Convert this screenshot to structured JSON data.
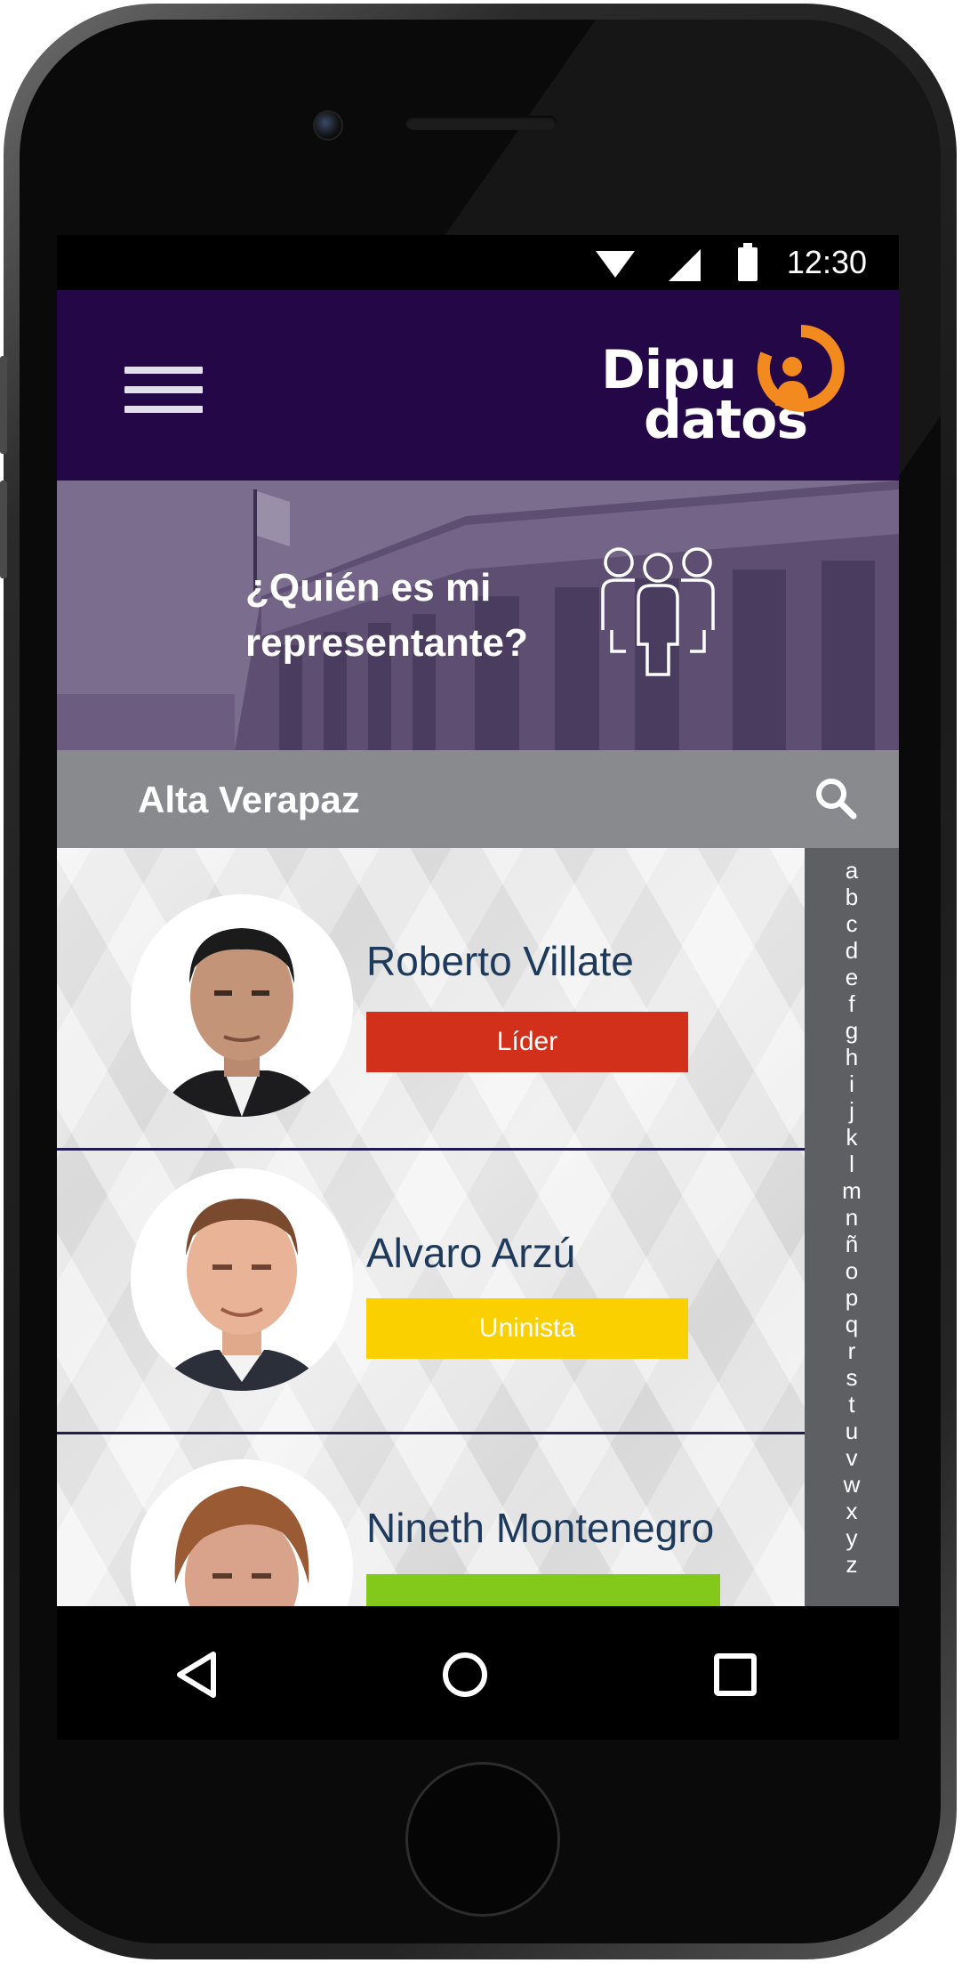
{
  "status_bar": {
    "time": "12:30"
  },
  "app_bar": {
    "logo_line1": "Dipu",
    "logo_line2": "datos"
  },
  "banner": {
    "line1": "¿Quién es mi",
    "line2": "representante?"
  },
  "search": {
    "label": "Alta Verapaz"
  },
  "representatives": [
    {
      "name": "Roberto Villate",
      "party": "Líder",
      "party_color": "#d3301b"
    },
    {
      "name": "Alvaro Arzú",
      "party": "Uninista",
      "party_color": "#fbd000"
    },
    {
      "name": "Nineth Montenegro",
      "party": "",
      "party_color": "#82c91c"
    }
  ],
  "alphabet": [
    "a",
    "b",
    "c",
    "d",
    "e",
    "f",
    "g",
    "h",
    "i",
    "j",
    "k",
    "l",
    "m",
    "n",
    "ñ",
    "o",
    "p",
    "q",
    "r",
    "s",
    "t",
    "u",
    "v",
    "w",
    "x",
    "y",
    "z"
  ],
  "colors": {
    "app_bar": "#240746",
    "accent_orange": "#f28a1f",
    "name_text": "#1d3a5c",
    "divider": "#1d1d4e"
  },
  "icons": {
    "menu": "hamburger-icon",
    "search": "search-icon",
    "group": "people-group-icon",
    "back": "back-triangle-icon",
    "home": "home-circle-icon",
    "recents": "recents-square-icon"
  }
}
